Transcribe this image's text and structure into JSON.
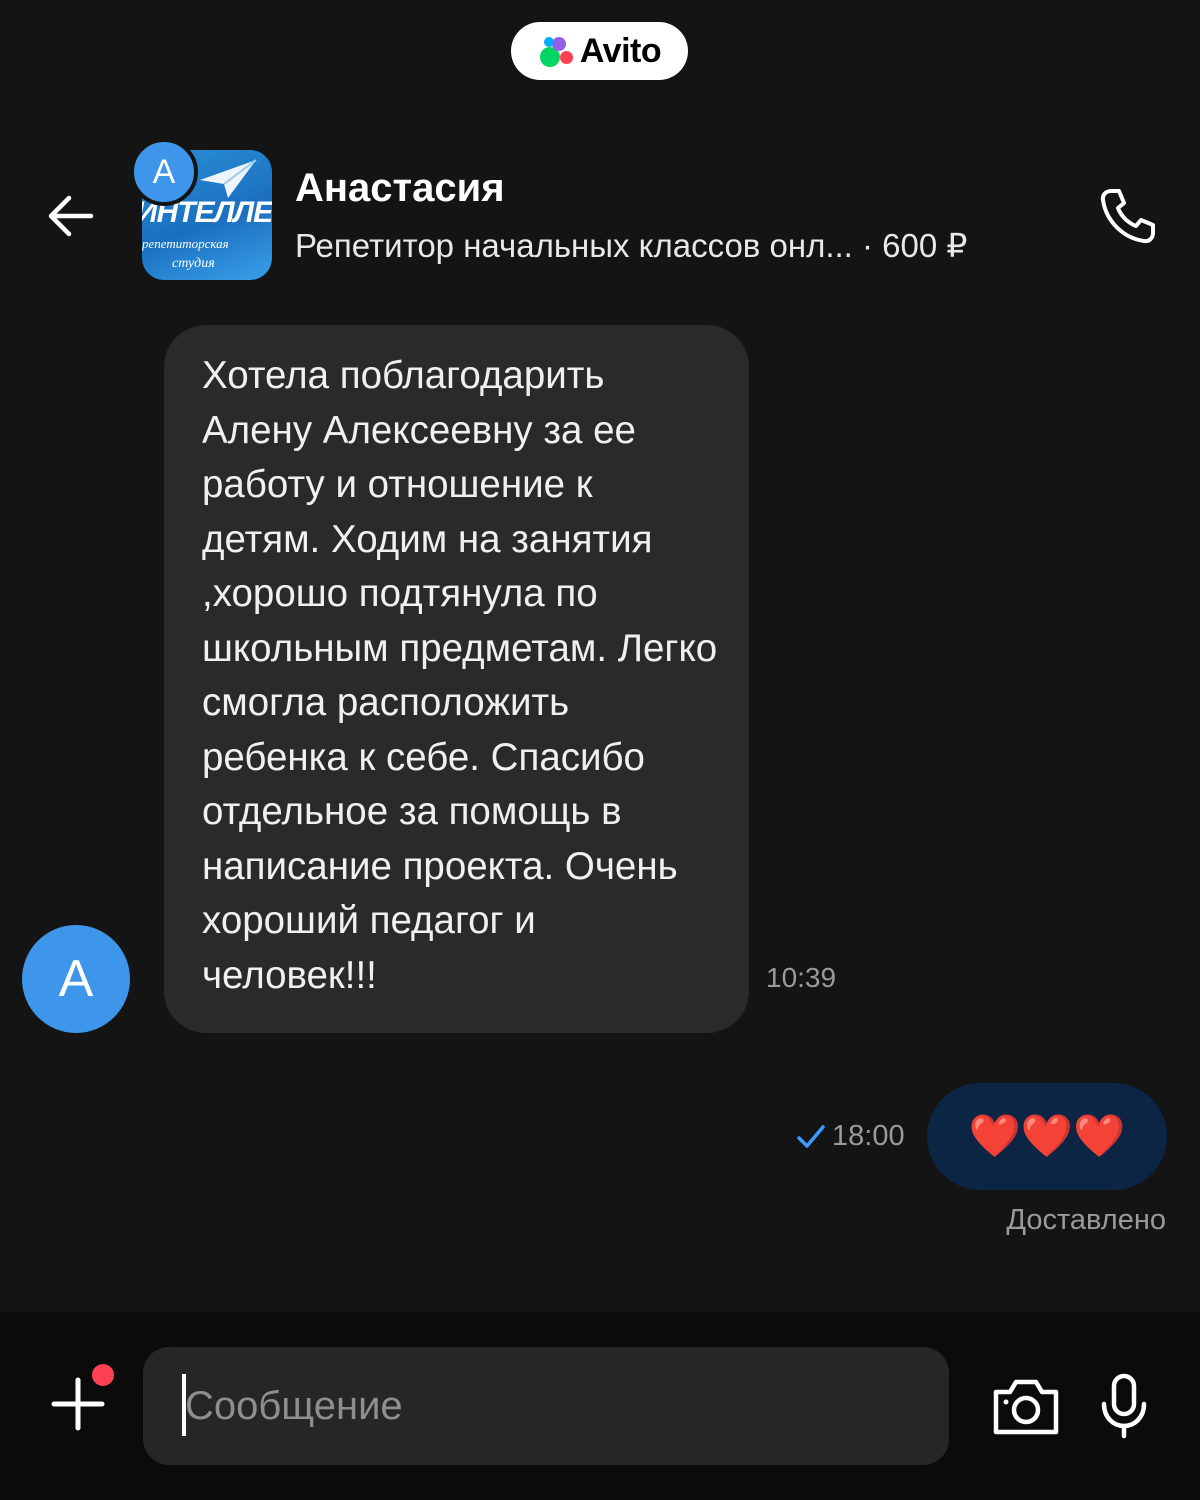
{
  "badge": {
    "brand": "Avito"
  },
  "header": {
    "avatar_initial": "A",
    "contact_name": "Анастасия",
    "listing_title": "Репетитор начальных классов онл... · 600 ₽",
    "thumb_logo_text": "ИНТЕЛЛЕКТ",
    "thumb_sub1": "репетиторская",
    "thumb_sub2": "студия"
  },
  "messages": {
    "incoming": {
      "avatar_initial": "A",
      "text": "Хотела поблагодарить Алену Алексеевну  за ее работу и отношение к детям. Ходим на занятия ,хорошо подтянула по школьным предметам. Легко смогла расположить ребенка к себе. Спасибо отдельное за помощь в написание проекта. Очень хороший педагог и человек!!!",
      "time": "10:39"
    },
    "outgoing": {
      "text": "❤️❤️❤️",
      "time": "18:00",
      "status": "Доставлено"
    }
  },
  "composer": {
    "placeholder": "Сообщение"
  },
  "icons": {
    "back": "arrow-left-icon",
    "call": "phone-icon",
    "add": "plus-icon",
    "camera": "camera-icon",
    "mic": "microphone-icon",
    "check": "check-icon"
  },
  "colors": {
    "background": "#141414",
    "incoming_bubble": "#2a2a2a",
    "outgoing_bubble": "#0c2544",
    "avatar": "#3d96ea",
    "check": "#3b9cff",
    "notification_dot": "#ff4053"
  }
}
